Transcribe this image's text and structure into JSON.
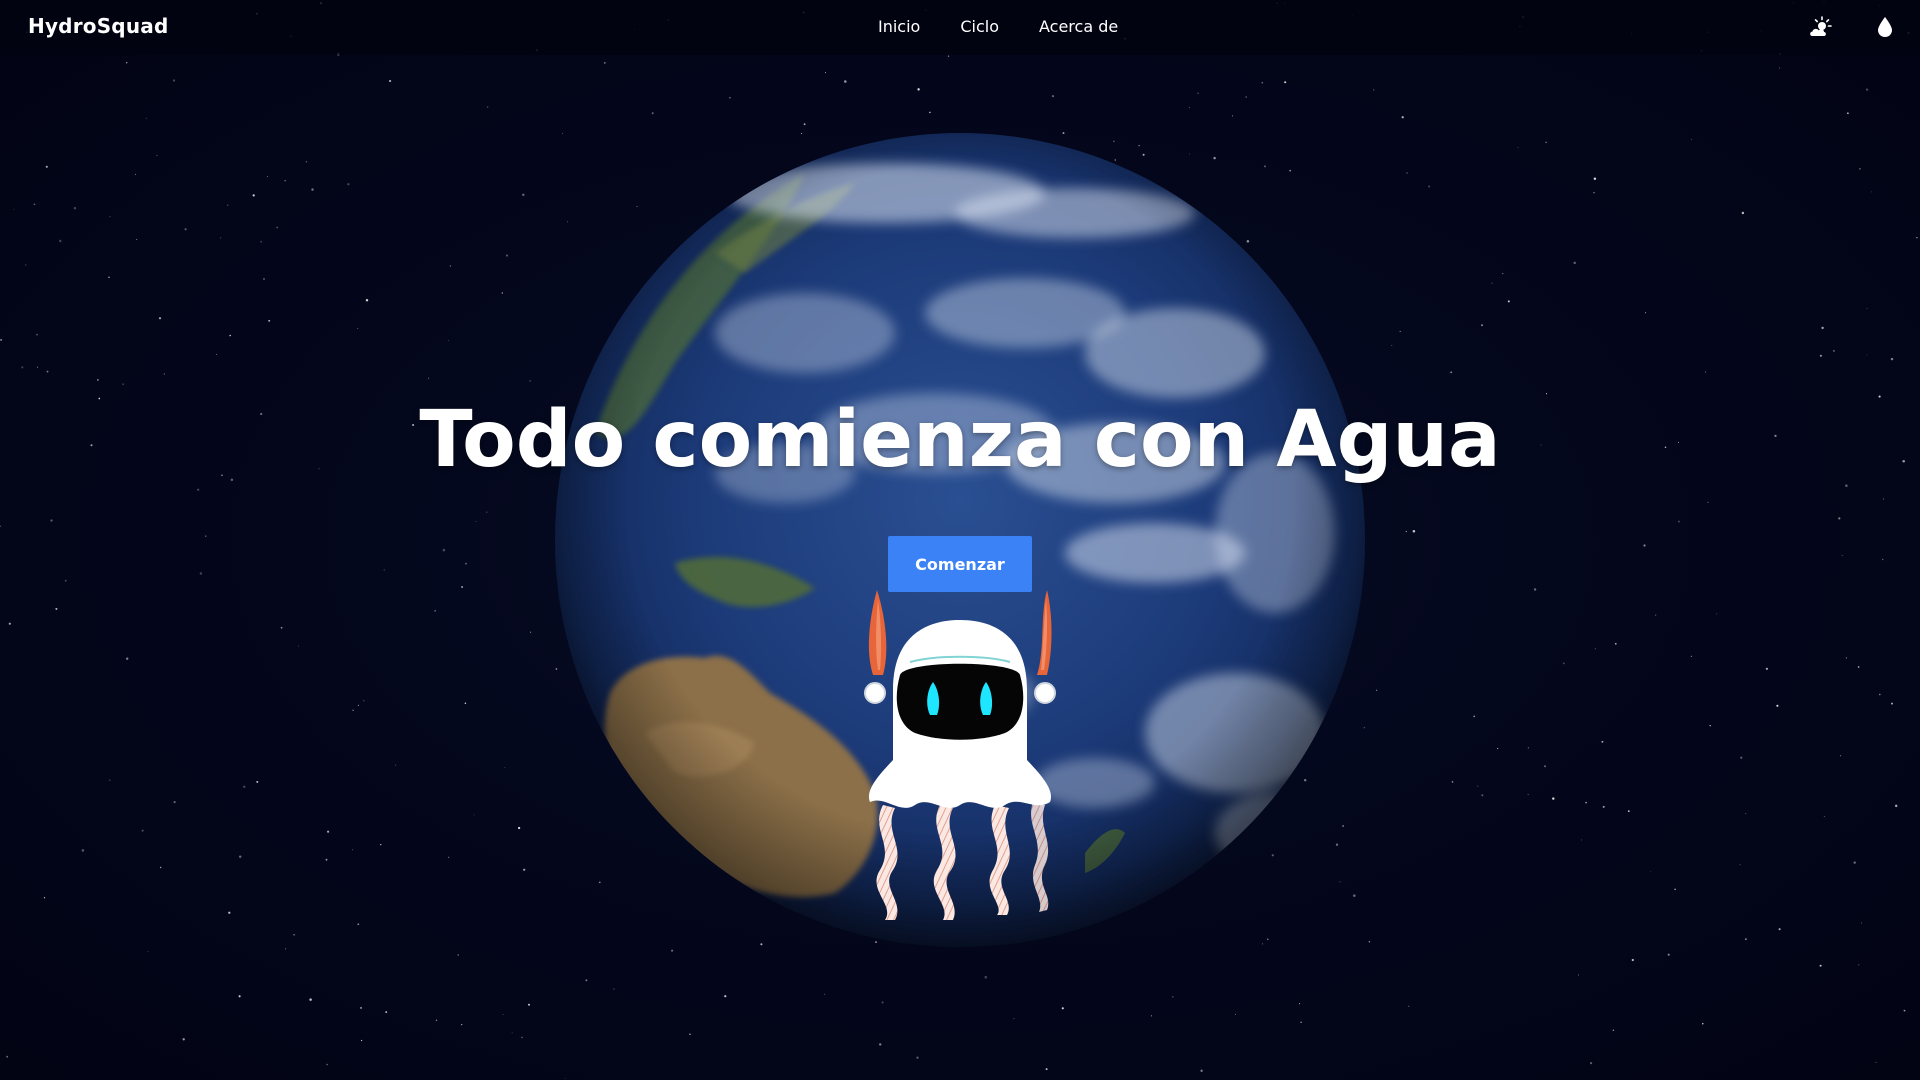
{
  "navbar": {
    "brand": "HydroSquad",
    "links": [
      "Inicio",
      "Ciclo",
      "Acerca de"
    ],
    "icons": [
      "weather-icon",
      "water-drop-icon"
    ]
  },
  "hero": {
    "title": "Todo comienza con Agua",
    "cta_label": "Comenzar"
  },
  "colors": {
    "background": "#04081a",
    "accent": "#3b82f6",
    "text": "#ffffff",
    "ocean": "#1f3f7a",
    "mascot_horns": "#e8653a",
    "mascot_eyes": "#1ee6ff"
  }
}
